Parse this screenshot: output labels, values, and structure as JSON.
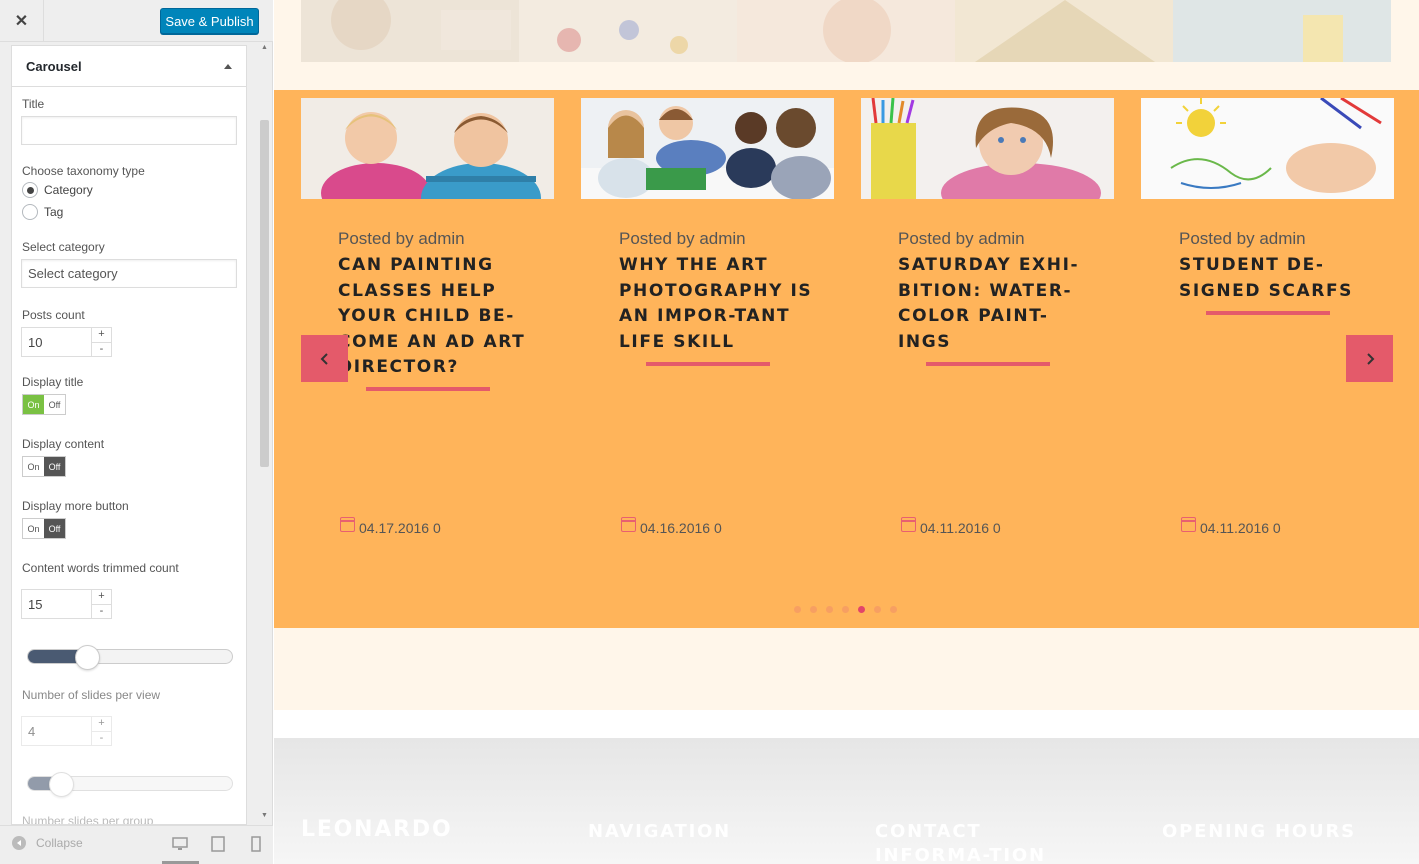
{
  "toolbar": {
    "close_icon": "close-icon",
    "save_label": "Save & Publish"
  },
  "panel": {
    "title": "Carousel",
    "title_label": "Title",
    "title_value": "",
    "taxonomy_label": "Choose taxonomy type",
    "taxonomy_options": [
      "Category",
      "Tag"
    ],
    "taxonomy_selected": "Category",
    "category_label": "Select category",
    "category_placeholder": "Select category",
    "posts_count_label": "Posts count",
    "posts_count_value": "10",
    "display_title_label": "Display title",
    "display_content_label": "Display content",
    "display_more_label": "Display more button",
    "toggle_on": "On",
    "toggle_off": "Off",
    "display_title_state": "on",
    "display_content_state": "off",
    "display_more_state": "off",
    "trim_label": "Content words trimmed count",
    "trim_value": "15",
    "trim_slider_fraction": 0.26,
    "slides_label": "Number of slides per view",
    "slides_value": "4",
    "slides_slider_fraction": 0.13,
    "spinner_plus": "+",
    "spinner_minus": "-",
    "next_label_partial": "Number slides per group"
  },
  "bottombar": {
    "collapse_label": "Collapse",
    "icons": [
      "desktop-icon",
      "tablet-icon",
      "mobile-icon"
    ]
  },
  "carousel": {
    "posts": [
      {
        "meta": "Posted by admin",
        "title": "CAN PAINTING CLASSES HELP YOUR CHILD BE-COME AN AD ART DIRECTOR?",
        "date": "04.17.2016 0"
      },
      {
        "meta": "Posted by admin",
        "title": "WHY THE ART PHOTOGRAPHY IS AN IMPOR-TANT LIFE SKILL",
        "date": "04.16.2016 0"
      },
      {
        "meta": "Posted by admin",
        "title": "SATURDAY EXHI-BITION: WATER-COLOR PAINT-INGS",
        "date": "04.11.2016 0"
      },
      {
        "meta": "Posted by admin",
        "title": "STUDENT DE-SIGNED SCARFS",
        "date": "04.11.2016 0"
      }
    ],
    "dots_count": 7,
    "active_dot": 4,
    "prev_icon": "chevron-left-icon",
    "next_icon": "chevron-right-icon",
    "colors": {
      "background": "#ffb45a",
      "accent": "#e45a6a"
    }
  },
  "footer": {
    "logo": "LEONARDO",
    "navigation": "NAVIGATION",
    "contact": "CONTACT INFORMA-TION",
    "hours": "OPENING HOURS"
  }
}
